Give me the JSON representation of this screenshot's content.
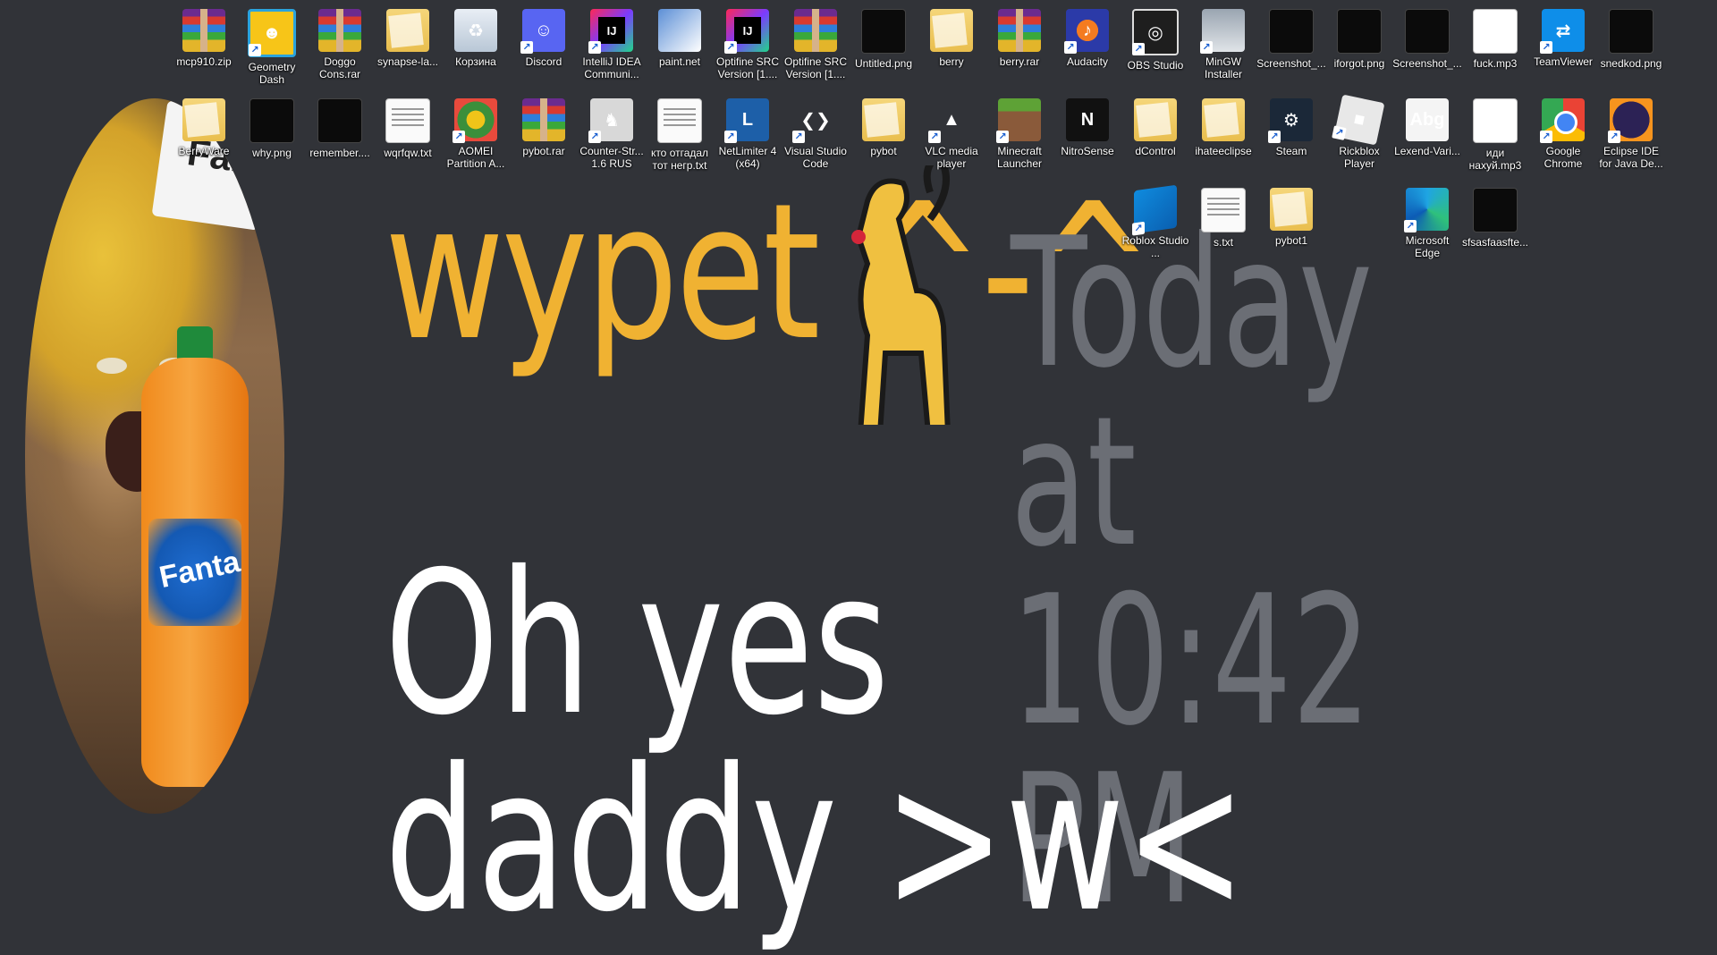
{
  "message": {
    "username": "wypet ^-^",
    "timestamp": "Today at 10:42 PM",
    "text": "Oh yes daddy >w<",
    "avatar_sign_text": "Fan",
    "bottle_label": "Fanta"
  },
  "desktop": {
    "row1": [
      {
        "label": "mcp910.zip",
        "icon": "winrar-icon"
      },
      {
        "label": "Geometry Dash",
        "icon": "geometry-dash-icon"
      },
      {
        "label": "Doggo Cons.rar",
        "icon": "winrar-icon"
      },
      {
        "label": "synapse-la...",
        "icon": "folder-icon"
      },
      {
        "label": "Корзина",
        "icon": "recycle-bin-icon"
      },
      {
        "label": "Discord",
        "icon": "discord-icon"
      },
      {
        "label": "IntelliJ IDEA Communi...",
        "icon": "intellij-icon"
      },
      {
        "label": "paint.net",
        "icon": "paint-net-icon"
      },
      {
        "label": "Optifine SRC Version [1....",
        "icon": "intellij-icon"
      },
      {
        "label": "Optifine SRC Version [1....",
        "icon": "winrar-icon"
      },
      {
        "label": "Untitled.png",
        "icon": "image-icon"
      },
      {
        "label": "berry",
        "icon": "folder-icon"
      },
      {
        "label": "berry.rar",
        "icon": "winrar-icon"
      },
      {
        "label": "Audacity",
        "icon": "audacity-icon"
      },
      {
        "label": "OBS Studio",
        "icon": "obs-icon"
      },
      {
        "label": "MinGW Installer",
        "icon": "mingw-icon"
      },
      {
        "label": "Screenshot_...",
        "icon": "image-icon"
      },
      {
        "label": "iforgot.png",
        "icon": "image-icon"
      },
      {
        "label": "Screenshot_...",
        "icon": "image-icon"
      },
      {
        "label": "fuck.mp3",
        "icon": "audio-file-icon"
      },
      {
        "label": "TeamViewer",
        "icon": "teamviewer-icon"
      },
      {
        "label": "snedkod.png",
        "icon": "image-icon"
      }
    ],
    "row2": [
      {
        "label": "BerryWare",
        "icon": "folder-icon"
      },
      {
        "label": "why.png",
        "icon": "image-icon"
      },
      {
        "label": "remember....",
        "icon": "image-icon"
      },
      {
        "label": "wqrfqw.txt",
        "icon": "text-file-icon"
      },
      {
        "label": "AOMEI Partition A...",
        "icon": "aomei-icon"
      },
      {
        "label": "pybot.rar",
        "icon": "winrar-icon"
      },
      {
        "label": "Counter-Str... 1.6 RUS",
        "icon": "counter-strike-icon"
      },
      {
        "label": "кто отгадал тот негр.txt",
        "icon": "text-file-icon"
      },
      {
        "label": "NetLimiter 4 (x64)",
        "icon": "netlimiter-icon"
      },
      {
        "label": "Visual Studio Code",
        "icon": "vscode-icon"
      },
      {
        "label": "pybot",
        "icon": "folder-icon"
      },
      {
        "label": "VLC media player",
        "icon": "vlc-icon"
      },
      {
        "label": "Minecraft Launcher",
        "icon": "minecraft-icon"
      },
      {
        "label": "NitroSense",
        "icon": "nitrosense-icon"
      },
      {
        "label": "dControl",
        "icon": "folder-icon"
      },
      {
        "label": "ihateeclipse",
        "icon": "folder-icon"
      },
      {
        "label": "Steam",
        "icon": "steam-icon"
      },
      {
        "label": "Rickblox Player",
        "icon": "roblox-icon"
      },
      {
        "label": "Lexend-Vari...",
        "icon": "font-file-icon"
      },
      {
        "label": "иди нахуй.mp3",
        "icon": "audio-file-icon"
      },
      {
        "label": "Google Chrome",
        "icon": "chrome-icon"
      },
      {
        "label": "Eclipse IDE for Java De...",
        "icon": "eclipse-icon"
      }
    ],
    "row3": [
      {
        "label": "Roblox Studio ...",
        "icon": "roblox-studio-icon"
      },
      {
        "label": "s.txt",
        "icon": "text-file-icon"
      },
      {
        "label": "pybot1",
        "icon": "folder-icon"
      },
      {
        "label": "Microsoft Edge",
        "icon": "edge-icon"
      },
      {
        "label": "sfsasfaasfte...",
        "icon": "image-icon"
      }
    ]
  }
}
